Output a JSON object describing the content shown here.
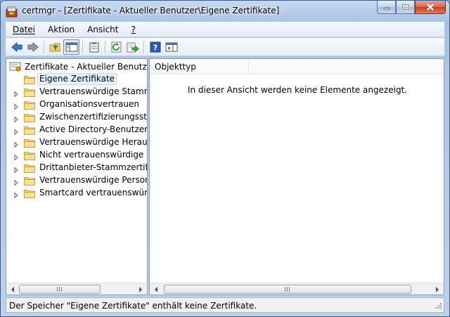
{
  "window": {
    "title": "certmgr - [Zertifikate - Aktueller Benutzer\\Eigene Zertifikate]",
    "app_icon": "certmgr-icon",
    "caption_buttons": [
      "minimize",
      "maximize",
      "close"
    ]
  },
  "menu": {
    "items": [
      {
        "label": "Datei",
        "access_key": "D"
      },
      {
        "label": "Aktion",
        "access_key": "k"
      },
      {
        "label": "Ansicht",
        "access_key": "A"
      },
      {
        "label": "?",
        "access_key": "?"
      }
    ]
  },
  "toolbar": {
    "buttons": [
      "back-arrow-icon",
      "forward-arrow-icon",
      "up-folder-icon",
      "show-tree-icon",
      "clipboard-icon",
      "refresh-icon",
      "export-list-icon",
      "help-icon",
      "action-pane-icon"
    ]
  },
  "tree": {
    "root": "Zertifikate - Aktueller Benutzer",
    "items": [
      {
        "label": "Eigene Zertifikate",
        "selected": true,
        "expandable": false
      },
      {
        "label": "Vertrauenswürdige Stammzer",
        "expandable": true
      },
      {
        "label": "Organisationsvertrauen",
        "expandable": true
      },
      {
        "label": "Zwischenzertifizierungssteller",
        "expandable": true
      },
      {
        "label": "Active Directory-Benutzerobj",
        "expandable": true
      },
      {
        "label": "Vertrauenswürdige Herausge",
        "expandable": true
      },
      {
        "label": "Nicht vertrauenswürdige Zert",
        "expandable": true
      },
      {
        "label": "Drittanbieter-Stammzertifizie",
        "expandable": true
      },
      {
        "label": "Vertrauenswürdige Personen",
        "expandable": true
      },
      {
        "label": "Smartcard vertrauenswürdige",
        "expandable": true
      }
    ]
  },
  "list": {
    "columns": [
      "Objekttyp"
    ],
    "empty_message": "In dieser Ansicht werden keine Elemente angezeigt."
  },
  "statusbar": {
    "text": "Der Speicher \"Eigene Zertifikate\" enthält keine Zertifikate."
  }
}
